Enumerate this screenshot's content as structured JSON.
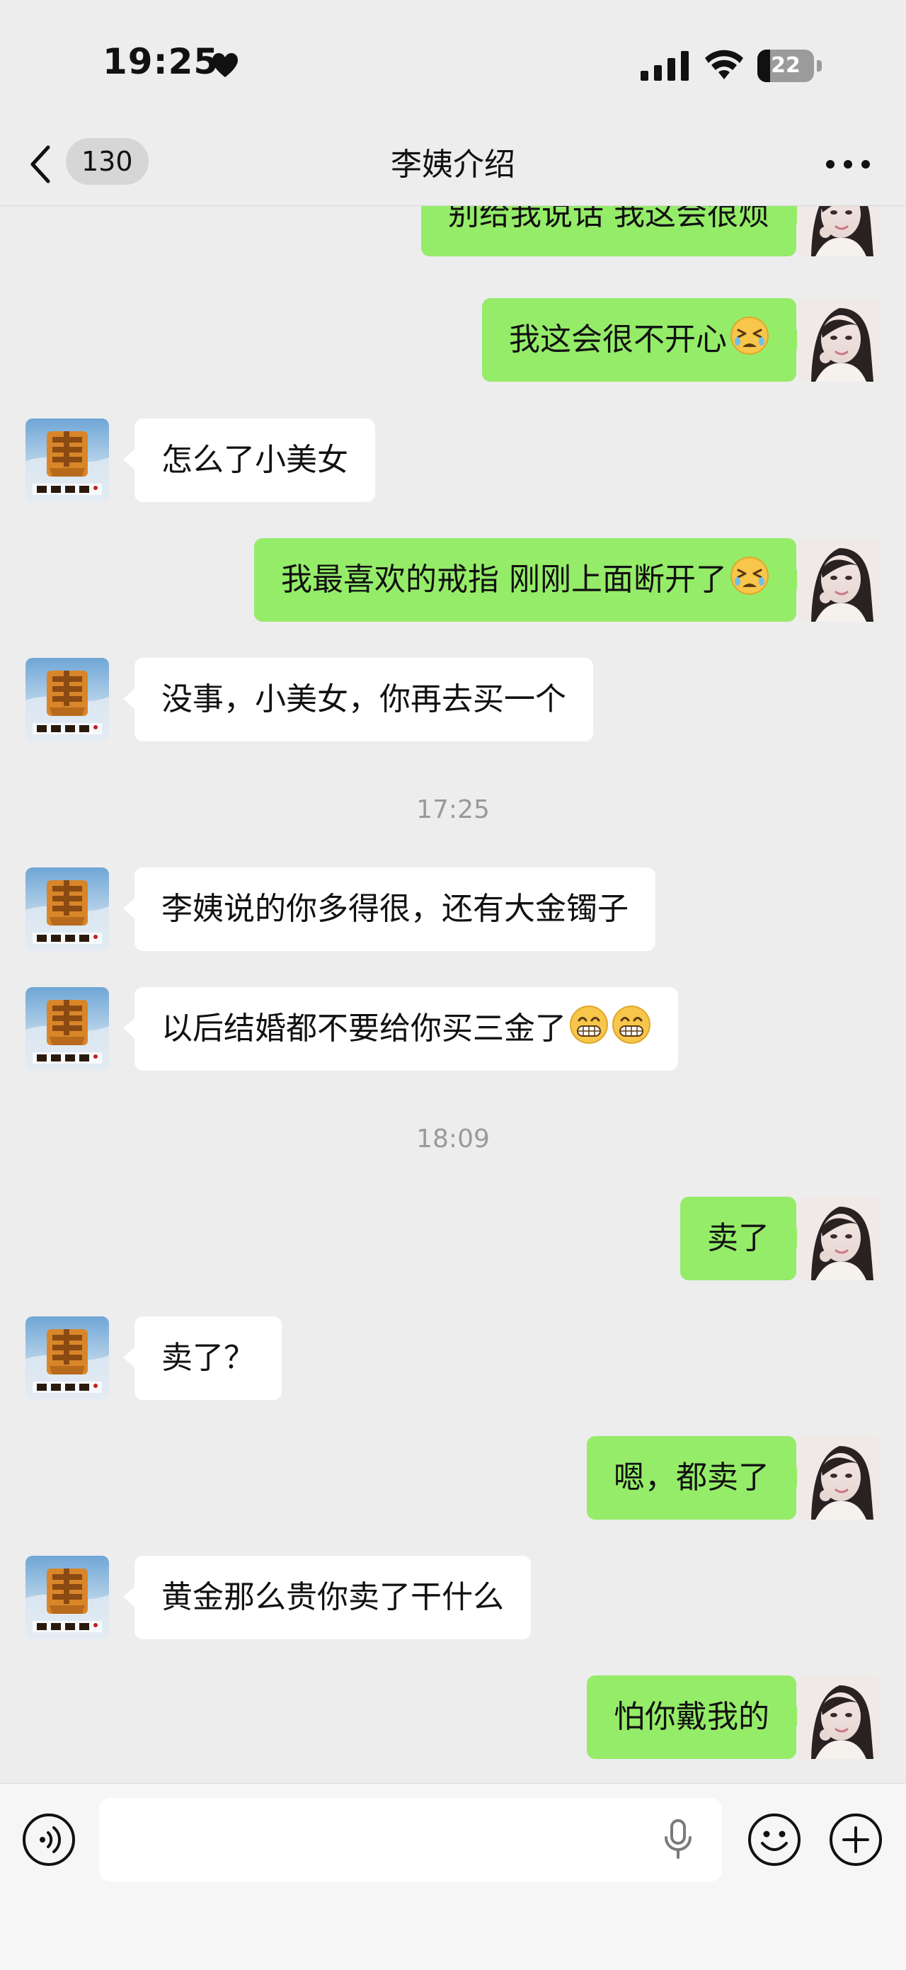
{
  "status_bar": {
    "time": "19:25",
    "battery": "22",
    "battery_level_percent": 22,
    "icons": [
      "heart-icon",
      "signal-icon",
      "wifi-icon",
      "battery-icon"
    ]
  },
  "nav": {
    "unread_count": "130",
    "title": "李姨介绍",
    "icons": [
      "back-chevron-icon",
      "more-icon"
    ]
  },
  "chat": {
    "messages": [
      {
        "sender": "me",
        "text": "别给我说话 我这会很烦"
      },
      {
        "sender": "me",
        "text": "我这会很不开心",
        "emoji": "tired-face-emoji"
      },
      {
        "sender": "them",
        "text": "怎么了小美女"
      },
      {
        "sender": "me",
        "text": "我最喜欢的戒指 刚刚上面断开了",
        "emoji": "tired-face-emoji"
      },
      {
        "sender": "them",
        "text": "没事，小美女，你再去买一个"
      },
      {
        "type": "timestamp",
        "text": "17:25"
      },
      {
        "sender": "them",
        "text": "李姨说的你多得很，还有大金镯子"
      },
      {
        "sender": "them",
        "text": "以后结婚都不要给你买三金了",
        "emoji": "grinning-face-emoji x2"
      },
      {
        "type": "timestamp",
        "text": "18:09"
      },
      {
        "sender": "me",
        "text": "卖了"
      },
      {
        "sender": "them",
        "text": "卖了？"
      },
      {
        "sender": "me",
        "text": "嗯，都卖了"
      },
      {
        "sender": "them",
        "text": "黄金那么贵你卖了干什么"
      },
      {
        "sender": "me",
        "text": "怕你戴我的"
      }
    ]
  },
  "input_bar": {
    "icons": [
      "voice-icon",
      "microphone-icon",
      "emoji-icon",
      "plus-icon"
    ]
  },
  "colors": {
    "background": "#ededed",
    "my_bubble": "#95ec69",
    "their_bubble": "#ffffff",
    "timestamp": "#9a9a9a"
  }
}
